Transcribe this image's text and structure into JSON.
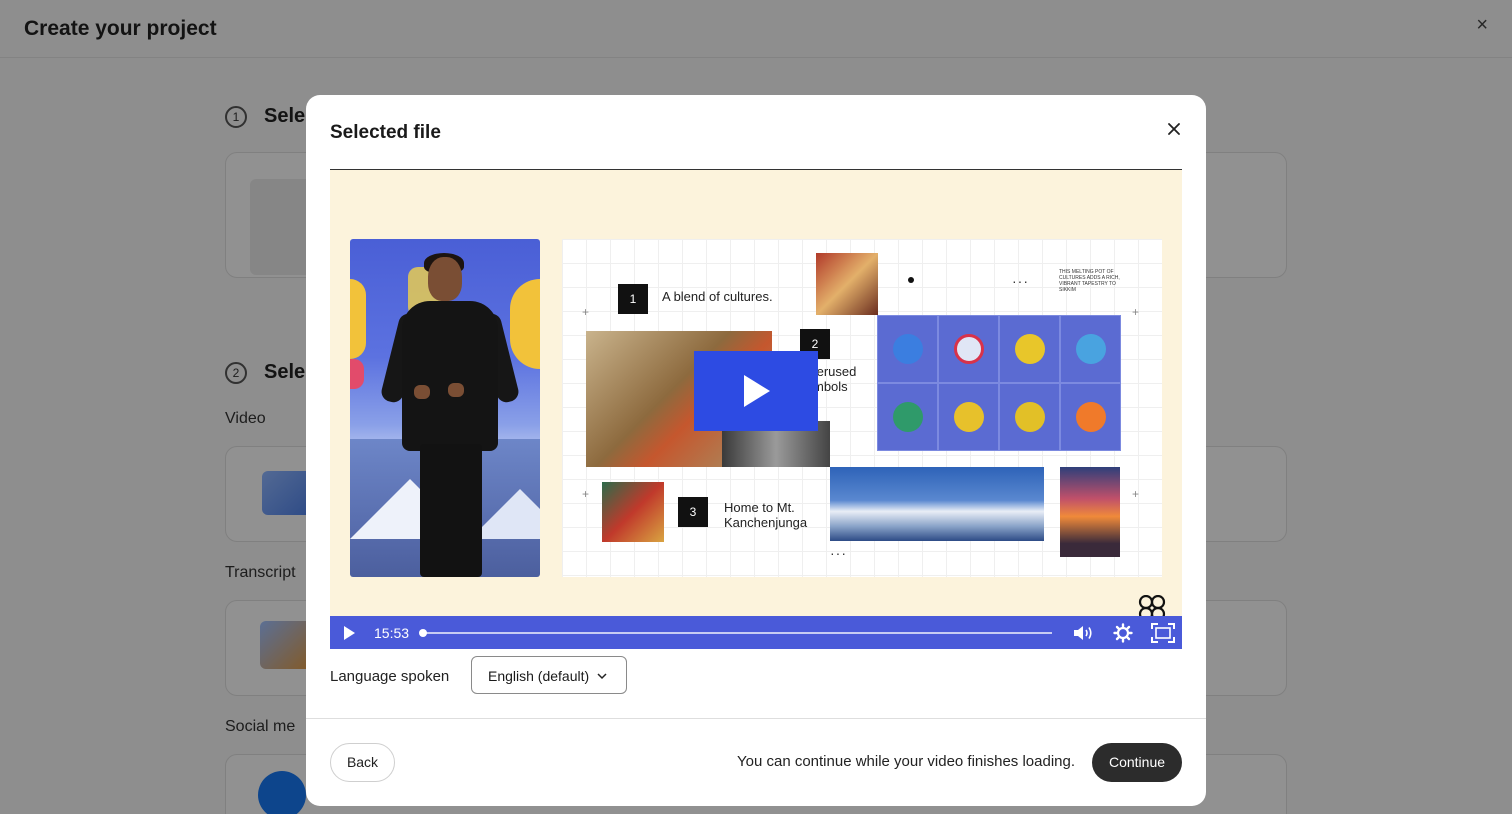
{
  "background": {
    "title": "Create your project",
    "step1_label": "Sele",
    "step2_label": "Sele",
    "video_label": "Video",
    "transcript_label": "Transcript",
    "social_label": "Social me"
  },
  "modal": {
    "title": "Selected file",
    "video": {
      "slide": {
        "item1_number": "1",
        "item1_text": "A blend of cultures.",
        "item2_number": "2",
        "item2_text": "Overused symbols",
        "item3_number": "3",
        "item3_text": "Home to Mt. Kanchenjunga",
        "small_caption": "This melting pot of cultures adds a rich, vibrant tapestry to Sikkim"
      },
      "duration": "15:53",
      "progress": 0
    },
    "language": {
      "label": "Language spoken",
      "selected": "English (default)"
    },
    "footer": {
      "back_label": "Back",
      "hint": "You can continue while your video finishes loading.",
      "continue_label": "Continue"
    }
  },
  "colors": {
    "accent": "#4a5ad9",
    "play_button": "#2d4be3",
    "continue_bg": "#2c2c2c",
    "player_bg": "#fcf3dc"
  }
}
